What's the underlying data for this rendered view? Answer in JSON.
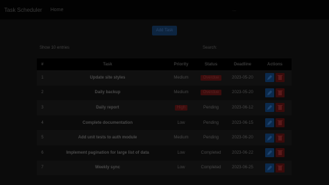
{
  "nav": {
    "brand": "Task Scheduler",
    "link": "Home",
    "right_text": "..."
  },
  "toolbar": {
    "add_label": "Add Task"
  },
  "table_controls": {
    "show_label": "Show 10 entries",
    "search_label": "Search:"
  },
  "table": {
    "headers": [
      "#",
      "Task",
      "Priority",
      "Status",
      "Deadline",
      "Actions"
    ],
    "rows": [
      {
        "num": "1",
        "task": "Update site styles",
        "priority": "Medium",
        "status": "Overdue",
        "deadline": "2023-05-20"
      },
      {
        "num": "2",
        "task": "Daily backup",
        "priority": "Medium",
        "status": "Overdue",
        "deadline": "2023-05-20"
      },
      {
        "num": "3",
        "task": "Daily report",
        "priority": "High",
        "status": "Pending",
        "deadline": "2023-06-12"
      },
      {
        "num": "4",
        "task": "Complete documentation",
        "priority": "Low",
        "status": "Pending",
        "deadline": "2023-06-15"
      },
      {
        "num": "5",
        "task": "Add unit tests to auth module",
        "priority": "Medium",
        "status": "Pending",
        "deadline": "2023-06-20"
      },
      {
        "num": "6",
        "task": "Implement pagination for large list of data",
        "priority": "Low",
        "status": "Completed",
        "deadline": "2023-06-22"
      },
      {
        "num": "7",
        "task": "Weekly sync",
        "priority": "Low",
        "status": "Completed",
        "deadline": "2023-06-25"
      }
    ]
  },
  "colors": {
    "primary": "#0b2a4d",
    "danger": "#3a0b0b",
    "background": "#0b0b0b"
  }
}
